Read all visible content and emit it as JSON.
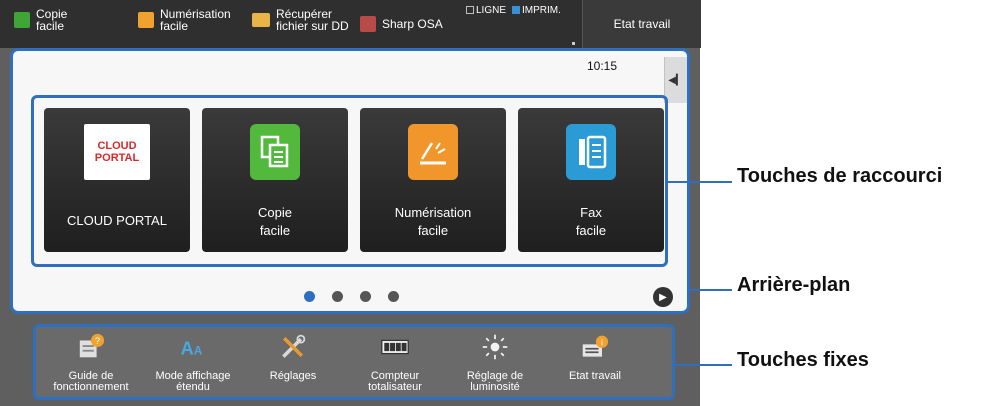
{
  "topbar": {
    "items": [
      {
        "label": "Copie\nfacile",
        "icon": "copy-icon"
      },
      {
        "label": "Numérisation\nfacile",
        "icon": "scan-icon"
      },
      {
        "label": "Récupérer\nfichier sur DD",
        "icon": "folder-icon"
      },
      {
        "label": "Sharp OSA",
        "icon": "osa-icon"
      }
    ],
    "status_line": "LIGNE",
    "status_print": "IMPRIM.",
    "job_status": "Etat travail"
  },
  "main": {
    "time": "10:15",
    "shortcuts": [
      {
        "label": "CLOUD PORTAL",
        "logo_line1": "CLOUD",
        "logo_line2": "PORTAL"
      },
      {
        "label": "Copie\nfacile"
      },
      {
        "label": "Numérisation\nfacile"
      },
      {
        "label": "Fax\nfacile"
      }
    ]
  },
  "fixed_keys": [
    {
      "label": "Guide de\nfonctionnement",
      "icon": "guide-icon"
    },
    {
      "label": "Mode affichage\nétendu",
      "icon": "text-size-icon"
    },
    {
      "label": "Réglages",
      "icon": "tools-icon"
    },
    {
      "label": "Compteur\ntotalisateur",
      "icon": "counter-icon"
    },
    {
      "label": "Réglage de\nluminosité",
      "icon": "brightness-icon"
    },
    {
      "label": "Etat travail",
      "icon": "job-status-icon"
    }
  ],
  "callouts": {
    "shortcut_keys": "Touches de raccourci",
    "background": "Arrière-plan",
    "fixed_keys": "Touches fixes"
  },
  "colors": {
    "accent": "#2f6fbf",
    "copy": "#52b93d",
    "scan": "#f0962a",
    "fax": "#2b9bd6"
  }
}
